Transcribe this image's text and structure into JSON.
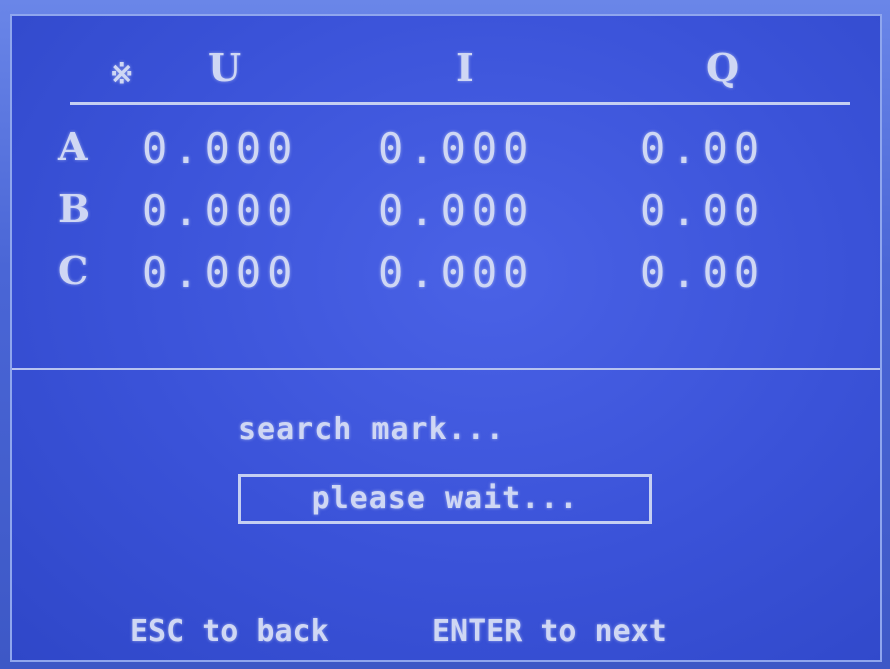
{
  "header": {
    "mark": "※",
    "u": "U",
    "i": "I",
    "q": "Q"
  },
  "rows": [
    {
      "phase": "A",
      "u": "0.000",
      "i": "0.000",
      "q": "0.00"
    },
    {
      "phase": "B",
      "u": "0.000",
      "i": "0.000",
      "q": "0.00"
    },
    {
      "phase": "C",
      "u": "0.000",
      "i": "0.000",
      "q": "0.00"
    }
  ],
  "status": {
    "message": "search mark...",
    "box_text": "please wait..."
  },
  "footer": {
    "esc_hint": "ESC to back",
    "enter_hint": "ENTER to next"
  },
  "colors": {
    "screen_bg": "#3a52d8",
    "text": "#cfd7f4"
  }
}
